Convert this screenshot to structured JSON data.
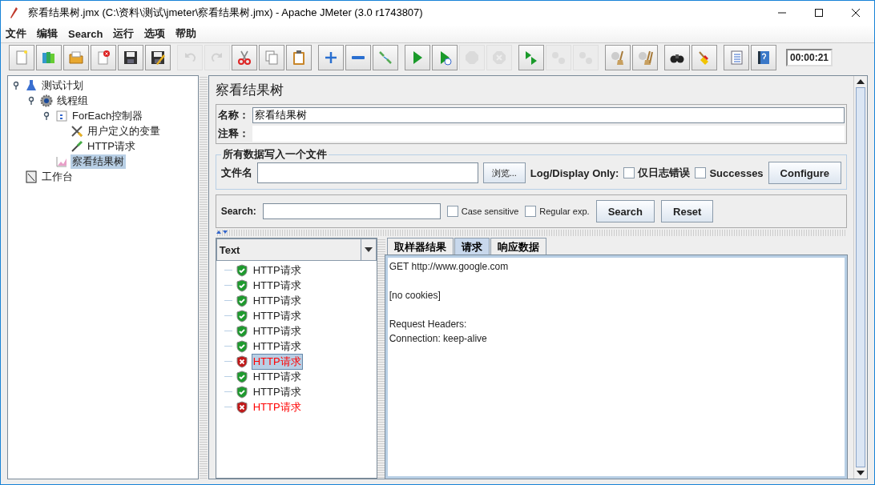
{
  "window": {
    "title": "察看结果树.jmx (C:\\资料\\测试\\jmeter\\察看结果树.jmx) - Apache JMeter (3.0 r1743807)"
  },
  "menu": [
    "文件",
    "编辑",
    "Search",
    "运行",
    "选项",
    "帮助"
  ],
  "toolbar": [
    {
      "buttons": [
        {
          "kind": "new",
          "disabled": false
        },
        {
          "kind": "templates",
          "disabled": false
        },
        {
          "kind": "open",
          "disabled": false
        },
        {
          "kind": "close",
          "disabled": false
        },
        {
          "kind": "save",
          "disabled": false
        },
        {
          "kind": "save-as",
          "disabled": false
        }
      ]
    },
    {
      "buttons": [
        {
          "kind": "undo",
          "disabled": true
        },
        {
          "kind": "redo",
          "disabled": true
        },
        {
          "kind": "cut",
          "disabled": false
        },
        {
          "kind": "copy",
          "disabled": false
        },
        {
          "kind": "paste",
          "disabled": false
        }
      ]
    },
    {
      "buttons": [
        {
          "kind": "expand",
          "disabled": false
        },
        {
          "kind": "collapse",
          "disabled": false
        },
        {
          "kind": "toggle",
          "disabled": false
        }
      ]
    },
    {
      "buttons": [
        {
          "kind": "start",
          "disabled": false
        },
        {
          "kind": "start-no-pause",
          "disabled": false
        },
        {
          "kind": "stop",
          "disabled": true
        },
        {
          "kind": "shutdown",
          "disabled": true
        }
      ]
    },
    {
      "buttons": [
        {
          "kind": "remote-start",
          "disabled": false
        },
        {
          "kind": "remote-stop",
          "disabled": true
        },
        {
          "kind": "remote-shutdown",
          "disabled": true
        }
      ]
    },
    {
      "buttons": [
        {
          "kind": "clear",
          "disabled": false
        },
        {
          "kind": "clear-all",
          "disabled": false
        }
      ]
    },
    {
      "buttons": [
        {
          "kind": "search",
          "disabled": false
        },
        {
          "kind": "reset-search",
          "disabled": false
        }
      ]
    },
    {
      "buttons": [
        {
          "kind": "function-helper",
          "disabled": false
        },
        {
          "kind": "help",
          "disabled": false
        }
      ]
    }
  ],
  "timer": "00:00:21",
  "tree": [
    {
      "label": "测试计划",
      "kind": "test-plan",
      "selected": false,
      "expanded": true,
      "children": [
        {
          "label": "线程组",
          "kind": "thread-group",
          "selected": false,
          "expanded": true,
          "children": [
            {
              "label": "ForEach控制器",
              "kind": "controller",
              "selected": false,
              "expanded": true,
              "children": [
                {
                  "label": "用户定义的变量",
                  "kind": "variables",
                  "selected": false
                },
                {
                  "label": "HTTP请求",
                  "kind": "sampler",
                  "selected": false
                }
              ]
            },
            {
              "label": "察看结果树",
              "kind": "listener",
              "selected": true
            }
          ]
        }
      ]
    },
    {
      "label": "工作台",
      "kind": "workbench",
      "selected": false
    }
  ],
  "panel": {
    "title": "察看结果树",
    "name_label": "名称：",
    "name_value": "察看结果树",
    "comment_label": "注释：",
    "file_group": {
      "legend": "所有数据写入一个文件",
      "file_label": "文件名",
      "browse": "浏览...",
      "log_label": "Log/Display Only:",
      "options": [
        {
          "label": "仅日志错误",
          "checked": false
        },
        {
          "label": "Successes",
          "checked": false
        }
      ],
      "configure": "Configure"
    },
    "search": {
      "label": "Search:",
      "options": [
        {
          "label": "Case sensitive",
          "checked": false
        },
        {
          "label": "Regular exp.",
          "checked": false
        }
      ],
      "search_button": "Search",
      "reset_button": "Reset"
    }
  },
  "results": {
    "renderer": "Text",
    "items": [
      {
        "label": "HTTP请求",
        "success": true,
        "selected": false
      },
      {
        "label": "HTTP请求",
        "success": true,
        "selected": false
      },
      {
        "label": "HTTP请求",
        "success": true,
        "selected": false
      },
      {
        "label": "HTTP请求",
        "success": true,
        "selected": false
      },
      {
        "label": "HTTP请求",
        "success": true,
        "selected": false
      },
      {
        "label": "HTTP请求",
        "success": true,
        "selected": false
      },
      {
        "label": "HTTP请求",
        "success": false,
        "selected": true
      },
      {
        "label": "HTTP请求",
        "success": true,
        "selected": false
      },
      {
        "label": "HTTP请求",
        "success": true,
        "selected": false
      },
      {
        "label": "HTTP请求",
        "success": false,
        "selected": false
      }
    ],
    "tabs": [
      {
        "label": "取样器结果",
        "selected": false
      },
      {
        "label": "请求",
        "selected": true
      },
      {
        "label": "响应数据",
        "selected": false
      }
    ],
    "paragraphs": [
      [
        "GET http://www.google.com"
      ],
      [
        "[no cookies]"
      ],
      [
        "Request Headers:",
        "Connection: keep-alive"
      ]
    ]
  }
}
